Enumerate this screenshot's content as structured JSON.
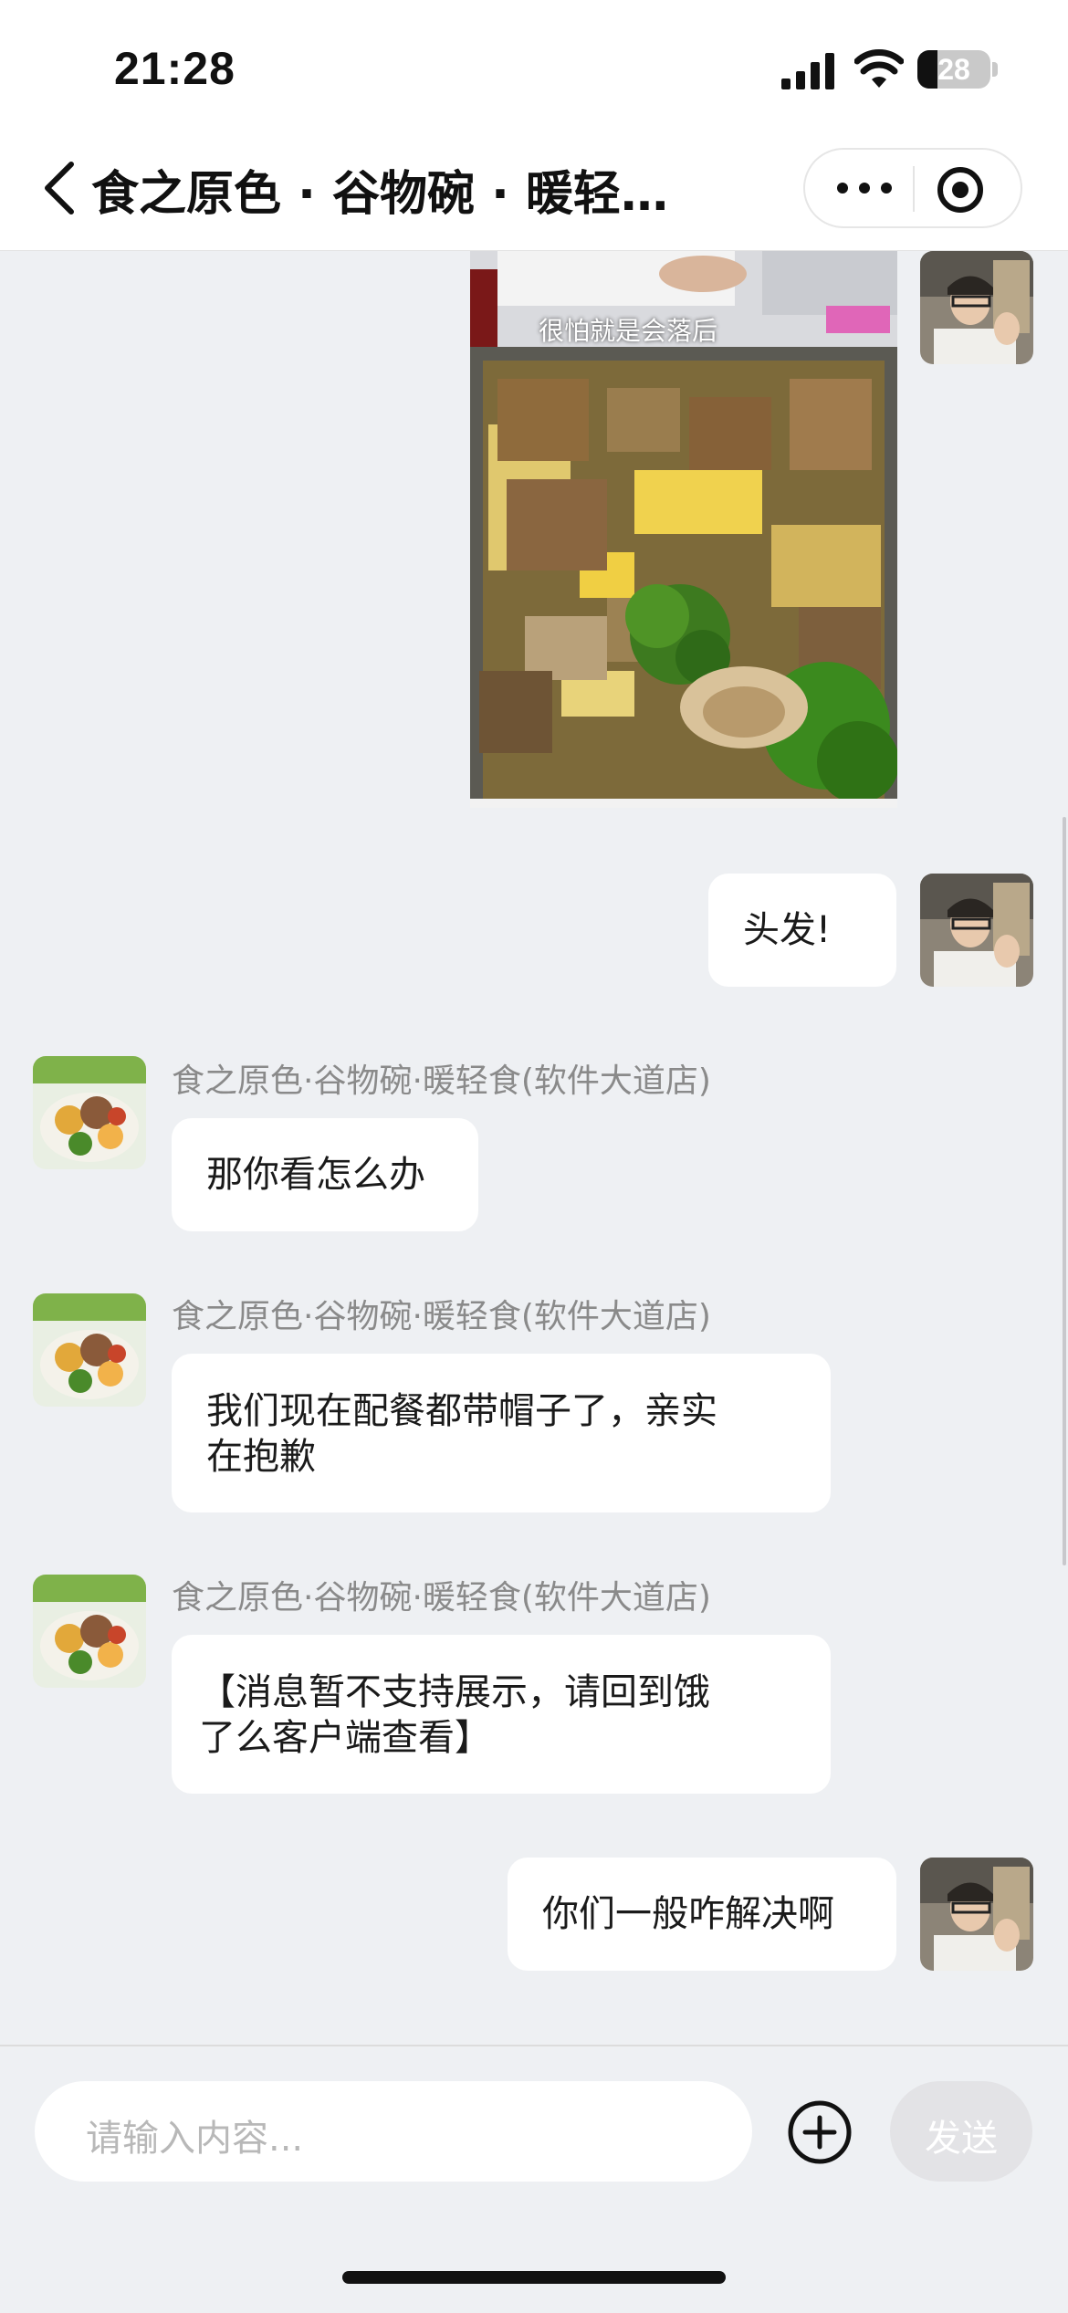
{
  "status_bar": {
    "time": "21:28",
    "battery": "28",
    "battery_level": 0.28
  },
  "navbar": {
    "title": "食之原色 · 谷物碗 · 暖轻食(软件大道店)"
  },
  "messages": [
    {
      "side": "right",
      "type": "image",
      "caption": "很怕就是会落后"
    },
    {
      "side": "right",
      "type": "text",
      "text": "头发!"
    },
    {
      "side": "left",
      "sender": "食之原色·谷物碗·暖轻食(软件大道店)",
      "text": "那你看怎么办"
    },
    {
      "side": "left",
      "sender": "食之原色·谷物碗·暖轻食(软件大道店)",
      "text_lines": [
        "我们现在配餐都带帽子了，亲实",
        "在抱歉"
      ]
    },
    {
      "side": "left",
      "sender": "食之原色·谷物碗·暖轻食(软件大道店)",
      "text_lines": [
        "【消息暂不支持展示，请回到饿",
        "了么客户端查看】"
      ]
    },
    {
      "side": "right",
      "type": "text",
      "text": "你们一般咋解决啊"
    }
  ],
  "input": {
    "placeholder": "请输入内容...",
    "send_label": "发送"
  },
  "colors": {
    "background": "#eef0f3",
    "bubble": "#ffffff",
    "sender_text": "#8a8a8a",
    "send_disabled": "#e3e3e6"
  },
  "icons": [
    "back-chevron-icon",
    "more-dots-icon",
    "target-circle-icon",
    "plus-circle-icon"
  ]
}
